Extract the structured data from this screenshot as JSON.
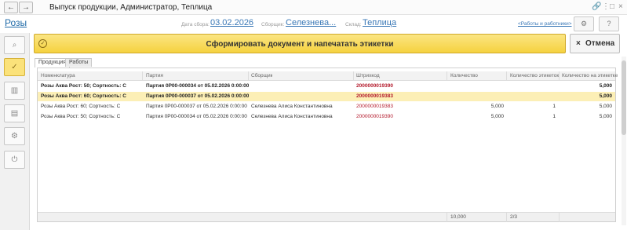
{
  "window": {
    "title": "Выпуск продукции, Администратор, Теплица",
    "back_icon": "←",
    "forward_icon": "→",
    "link_icon": "🔗",
    "more_icon": "⋮",
    "restore_icon": "□",
    "close_icon": "×"
  },
  "header": {
    "roses_link": "Розы",
    "date_label": "Дата сбора:",
    "date_value": "03.02.2026",
    "picker_label": "Сборщик:",
    "picker_value": "Селезнева...",
    "warehouse_label": "Склад:",
    "warehouse_value": "Теплица",
    "works_link": "<Работы и работники>",
    "settings_icon": "⚙",
    "help_icon": "?"
  },
  "sidebar": {
    "search_icon": "⌕",
    "check_icon": "✓",
    "barcode_icon": "▥",
    "document_icon": "▤",
    "gear_icon": "⚙",
    "power_icon": "⏻"
  },
  "actions": {
    "main_label": "Сформировать документ и напечатать этикетки",
    "main_icon": "✓",
    "cancel_label": "Отмена",
    "cancel_icon": "×"
  },
  "tabs": [
    "Продукция",
    "Работы"
  ],
  "table": {
    "columns": [
      "Номенклатура",
      "Партия",
      "Сборщик",
      "Штрихкод",
      "Количество",
      "Количество этикеток",
      "Количество на этикетке"
    ],
    "rows": [
      {
        "nom": "Розы Аква Рост: 50; Сортность: С",
        "batch": "Партия 0Р00-000034 от 05.02.2026 0:00:00",
        "picker": "",
        "barcode": "2000000019390",
        "qty": "",
        "labels": "",
        "per_label": "5,000"
      },
      {
        "nom": "Розы Аква Рост: 60; Сортность: С",
        "batch": "Партия 0Р00-000037 от 05.02.2026 0:00:00",
        "picker": "",
        "barcode": "2000000019383",
        "qty": "",
        "labels": "",
        "per_label": "5,000"
      },
      {
        "nom": "Розы Аква Рост: 60; Сортность: С",
        "batch": "Партия 0Р00-000037 от 05.02.2026 0:00:00",
        "picker": "Селезнева Алиса Константиновна",
        "barcode": "2000000019383",
        "qty": "5,000",
        "labels": "1",
        "per_label": "5,000"
      },
      {
        "nom": "Розы Аква Рост: 50; Сортность: С",
        "batch": "Партия 0Р00-000034 от 05.02.2026 0:00:00",
        "picker": "Селезнева Алиса Константиновна",
        "barcode": "2000000019390",
        "qty": "5,000",
        "labels": "1",
        "per_label": "5,000"
      }
    ],
    "footer": {
      "qty_total": "10,000",
      "labels_total": "2/3"
    }
  }
}
